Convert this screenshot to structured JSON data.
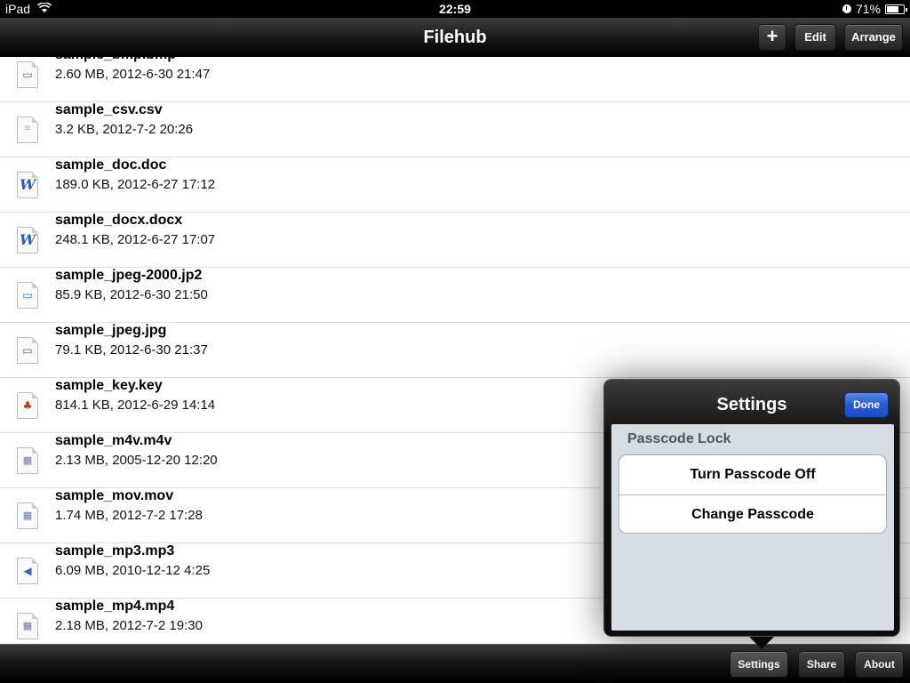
{
  "status_bar": {
    "device": "iPad",
    "time": "22:59",
    "battery": "71%",
    "battery_level": 0.71
  },
  "nav": {
    "title": "Filehub",
    "add_label": "+",
    "edit_label": "Edit",
    "arrange_label": "Arrange"
  },
  "files": [
    {
      "name": "sample_bmp.bmp",
      "meta": "2.60 MB, 2012-6-30 21:47",
      "icon": "image-file-icon",
      "glyph": "▭"
    },
    {
      "name": "sample_csv.csv",
      "meta": "3.2 KB, 2012-7-2 20:26",
      "icon": "text-file-icon",
      "glyph": "≡"
    },
    {
      "name": "sample_doc.doc",
      "meta": "189.0 KB, 2012-6-27 17:12",
      "icon": "word-file-icon",
      "glyph": "W"
    },
    {
      "name": "sample_docx.docx",
      "meta": "248.1 KB, 2012-6-27 17:07",
      "icon": "word-file-icon",
      "glyph": "W"
    },
    {
      "name": "sample_jpeg-2000.jp2",
      "meta": "85.9 KB, 2012-6-30 21:50",
      "icon": "image-file-icon",
      "glyph": "▭"
    },
    {
      "name": "sample_jpeg.jpg",
      "meta": "79.1 KB, 2012-6-30 21:37",
      "icon": "image-file-icon",
      "glyph": "▭"
    },
    {
      "name": "sample_key.key",
      "meta": "814.1 KB, 2012-6-29 14:14",
      "icon": "keynote-file-icon",
      "glyph": "♣"
    },
    {
      "name": "sample_m4v.m4v",
      "meta": "2.13 MB, 2005-12-20 12:20",
      "icon": "video-file-icon",
      "glyph": "▦"
    },
    {
      "name": "sample_mov.mov",
      "meta": "1.74 MB, 2012-7-2 17:28",
      "icon": "video-file-icon",
      "glyph": "▦"
    },
    {
      "name": "sample_mp3.mp3",
      "meta": "6.09 MB, 2010-12-12 4:25",
      "icon": "audio-file-icon",
      "glyph": "◀"
    },
    {
      "name": "sample_mp4.mp4",
      "meta": "2.18 MB, 2012-7-2 19:30",
      "icon": "video-file-icon",
      "glyph": "▦"
    }
  ],
  "toolbar": {
    "settings_label": "Settings",
    "share_label": "Share",
    "about_label": "About"
  },
  "popover": {
    "title": "Settings",
    "done_label": "Done",
    "section_header": "Passcode Lock",
    "options": [
      "Turn Passcode Off",
      "Change Passcode"
    ]
  },
  "colors": {
    "accent_done": "#2659d4",
    "section_text": "#4d5666",
    "list_background": "#ffffff"
  }
}
